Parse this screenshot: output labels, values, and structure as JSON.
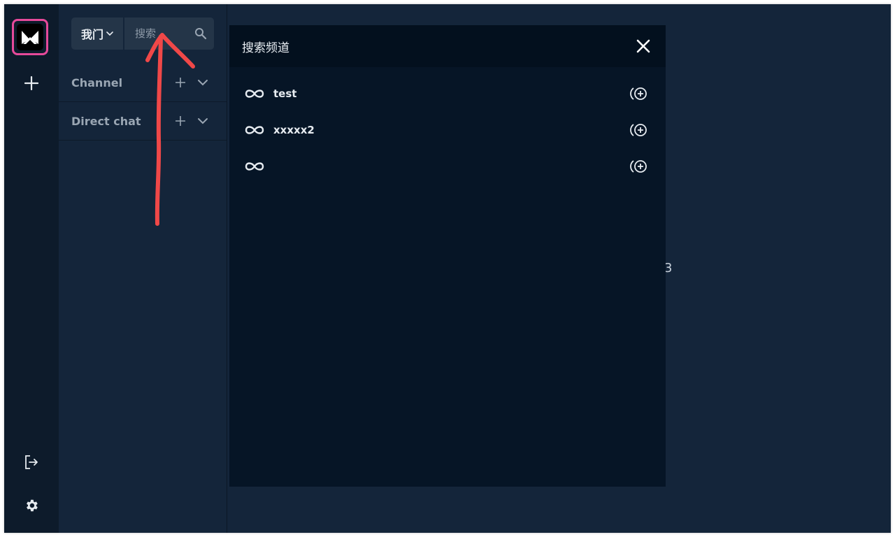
{
  "rail": {
    "logo_icon": "app-logo-icon",
    "add_icon": "plus-icon",
    "logout_icon": "logout-icon",
    "settings_icon": "gear-icon"
  },
  "panel": {
    "workspace_label": "我门",
    "search_placeholder": "搜索",
    "sections": [
      {
        "title": "Channel"
      },
      {
        "title": "Direct chat"
      }
    ]
  },
  "main": {
    "stray_text": "3"
  },
  "dialog": {
    "title": "搜索频道",
    "results": [
      {
        "name": "test"
      },
      {
        "name": "xxxxx2"
      },
      {
        "name": ""
      }
    ]
  },
  "colors": {
    "background": "#14253a",
    "rail": "#0d1b2b",
    "dialog": "#061526",
    "dialog_header": "#03101e",
    "logo_highlight": "#e64a9a",
    "annotation_arrow": "#f04848"
  }
}
